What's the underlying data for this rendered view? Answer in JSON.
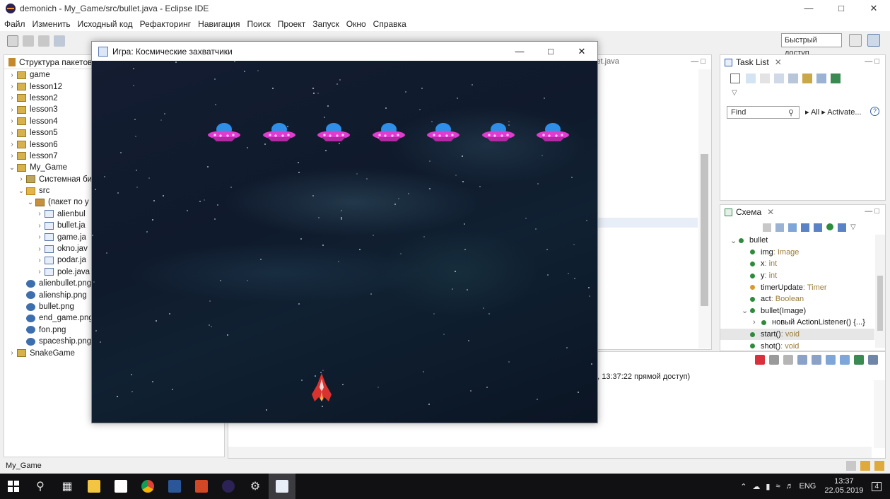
{
  "ide": {
    "window_title": "demonich - My_Game/src/bullet.java - Eclipse IDE",
    "menu": [
      "Файл",
      "Изменить",
      "Исходный код",
      "Рефакторинг",
      "Навигация",
      "Поиск",
      "Проект",
      "Запуск",
      "Окно",
      "Справка"
    ],
    "quick_access": "Быстрый доступ"
  },
  "package_explorer": {
    "title": "Структура пакетов",
    "items": [
      {
        "label": "game",
        "arrow": "›",
        "indent": 0,
        "icon": "project-icon"
      },
      {
        "label": "lesson12",
        "arrow": "›",
        "indent": 0,
        "icon": "project-icon"
      },
      {
        "label": "lesson2",
        "arrow": "›",
        "indent": 0,
        "icon": "project-icon"
      },
      {
        "label": "lesson3",
        "arrow": "›",
        "indent": 0,
        "icon": "project-icon"
      },
      {
        "label": "lesson4",
        "arrow": "›",
        "indent": 0,
        "icon": "project-icon"
      },
      {
        "label": "lesson5",
        "arrow": "›",
        "indent": 0,
        "icon": "project-icon"
      },
      {
        "label": "lesson6",
        "arrow": "›",
        "indent": 0,
        "icon": "project-icon"
      },
      {
        "label": "lesson7",
        "arrow": "›",
        "indent": 0,
        "icon": "project-icon"
      },
      {
        "label": "My_Game",
        "arrow": "⌄",
        "indent": 0,
        "icon": "project-icon"
      },
      {
        "label": "Системная би",
        "arrow": "›",
        "indent": 1,
        "icon": "library-icon"
      },
      {
        "label": "src",
        "arrow": "⌄",
        "indent": 1,
        "icon": "source-folder-icon"
      },
      {
        "label": "(пакет по у",
        "arrow": "⌄",
        "indent": 2,
        "icon": "package-icon"
      },
      {
        "label": "alienbul",
        "arrow": "›",
        "indent": 3,
        "icon": "java-file-icon"
      },
      {
        "label": "bullet.ja",
        "arrow": "›",
        "indent": 3,
        "icon": "java-file-icon"
      },
      {
        "label": "game.ja",
        "arrow": "›",
        "indent": 3,
        "icon": "java-file-icon"
      },
      {
        "label": "okno.jav",
        "arrow": "›",
        "indent": 3,
        "icon": "java-file-icon"
      },
      {
        "label": "podar.ja",
        "arrow": "›",
        "indent": 3,
        "icon": "java-file-icon"
      },
      {
        "label": "pole.java",
        "arrow": "›",
        "indent": 3,
        "icon": "java-file-icon"
      },
      {
        "label": "alienbullet.png",
        "arrow": "",
        "indent": 1,
        "icon": "image-file-icon"
      },
      {
        "label": "alienship.png",
        "arrow": "",
        "indent": 1,
        "icon": "image-file-icon"
      },
      {
        "label": "bullet.png",
        "arrow": "",
        "indent": 1,
        "icon": "image-file-icon"
      },
      {
        "label": "end_game.png",
        "arrow": "",
        "indent": 1,
        "icon": "image-file-icon"
      },
      {
        "label": "fon.png",
        "arrow": "",
        "indent": 1,
        "icon": "image-file-icon"
      },
      {
        "label": "spaceship.png",
        "arrow": "",
        "indent": 1,
        "icon": "image-file-icon"
      },
      {
        "label": "SnakeGame",
        "arrow": "›",
        "indent": 0,
        "icon": "project-icon"
      }
    ]
  },
  "editor": {
    "tab_fragment": "let.java"
  },
  "console": {
    "line_fragment": "r., 13:37:22 прямой доступ)"
  },
  "task_list": {
    "title": "Task List",
    "find_placeholder": "Find",
    "links": "▸ All ▸ Activate..."
  },
  "outline": {
    "title": "Схема",
    "items": [
      {
        "name": "bullet",
        "type": "",
        "indent": 0,
        "color": "#2e8b3c",
        "arrow": "⌄"
      },
      {
        "name": "img",
        "type": " : Image",
        "indent": 1,
        "color": "#2e8b3c",
        "arrow": ""
      },
      {
        "name": "x",
        "type": " : int",
        "indent": 1,
        "color": "#2e8b3c",
        "arrow": ""
      },
      {
        "name": "y",
        "type": " : int",
        "indent": 1,
        "color": "#2e8b3c",
        "arrow": ""
      },
      {
        "name": "timerUpdate",
        "type": " : Timer",
        "indent": 1,
        "color": "#d89a2a",
        "arrow": ""
      },
      {
        "name": "act",
        "type": " : Boolean",
        "indent": 1,
        "color": "#2e8b3c",
        "arrow": ""
      },
      {
        "name": "bullet(Image)",
        "type": "",
        "indent": 1,
        "color": "#2e8b3c",
        "arrow": "⌄"
      },
      {
        "name": "новый ActionListener() {...}",
        "type": "",
        "indent": 2,
        "color": "#2e8b3c",
        "arrow": "›"
      },
      {
        "name": "start()",
        "type": " : void",
        "indent": 1,
        "color": "#2e8b3c",
        "arrow": ""
      },
      {
        "name": "shot()",
        "type": " : void",
        "indent": 1,
        "color": "#2e8b3c",
        "arrow": ""
      }
    ]
  },
  "status_bar": {
    "text": "My_Game"
  },
  "taskbar": {
    "lang": "ENG",
    "time": "13:37",
    "date": "22.05.2019",
    "notifications": "4"
  },
  "game": {
    "window_title": "Игра: Космические захватчики",
    "aliens": 7,
    "alien_colors": {
      "dome": "#2f8fe8",
      "body": "#e03ccf"
    },
    "ship_color": "#d8332f"
  }
}
